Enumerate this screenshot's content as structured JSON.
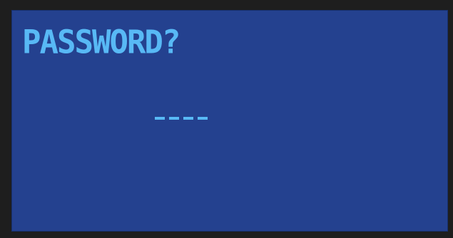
{
  "screen": {
    "prompt": "PASSWORD?",
    "entered_digits": 0,
    "slot_count": 4,
    "colors": {
      "bezel": "#1e1e1e",
      "background": "#24418f",
      "text": "#58b9f5"
    }
  }
}
